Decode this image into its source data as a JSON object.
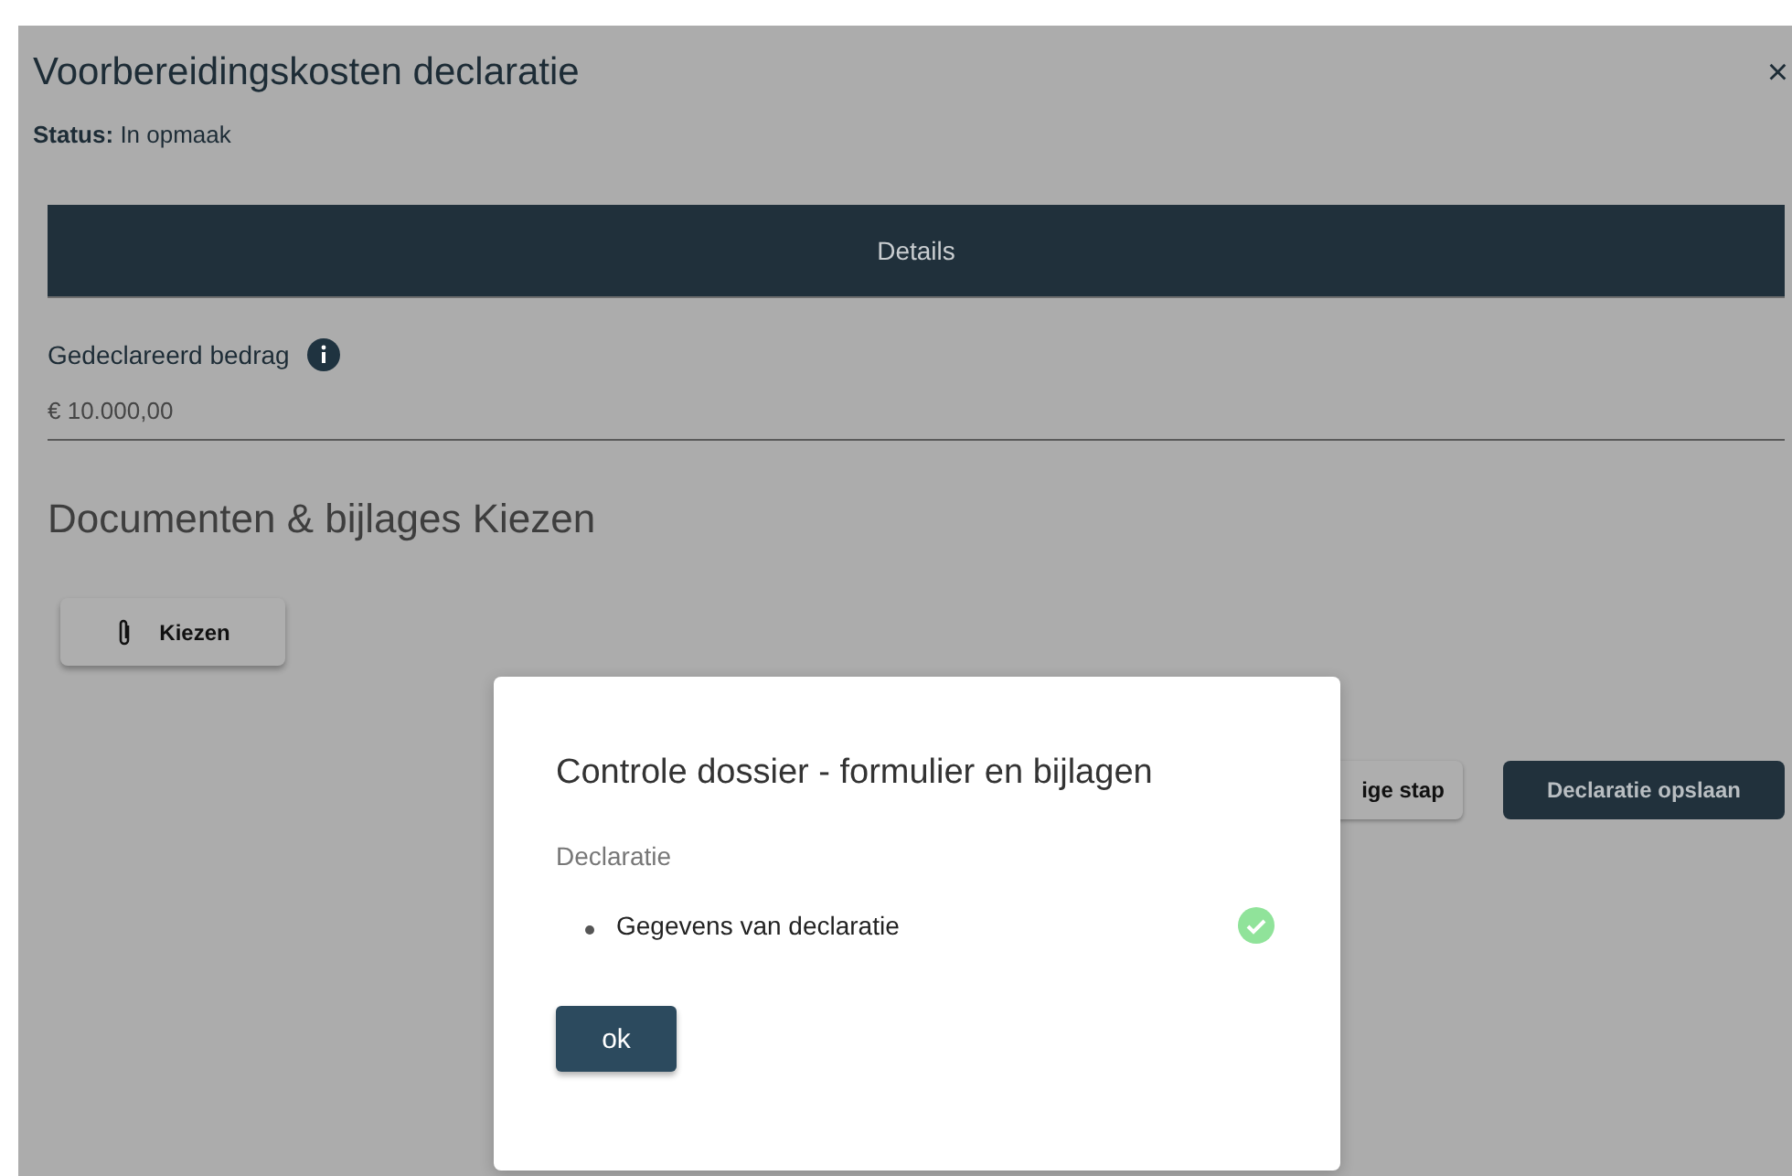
{
  "page": {
    "title": "Voorbereidingskosten declaratie",
    "close": "×",
    "status_label": "Status:",
    "status_value": "In opmaak"
  },
  "tabs": [
    {
      "label": "Details",
      "selected": true
    }
  ],
  "amount": {
    "label": "Gedeclareerd bedrag",
    "value": "€ 10.000,00"
  },
  "documents": {
    "heading": "Documenten & bijlages Kiezen",
    "button": "Kiezen"
  },
  "actions": [
    {
      "label": "ige stap",
      "kind": "secondary"
    },
    {
      "label": "Declaratie opslaan",
      "kind": "primary"
    }
  ],
  "dialog": {
    "title": "Controle dossier - formulier en bijlagen",
    "section": "Declaratie",
    "items": [
      {
        "label": "Gegevens van declaratie",
        "checked": true
      }
    ],
    "button": "ok"
  }
}
